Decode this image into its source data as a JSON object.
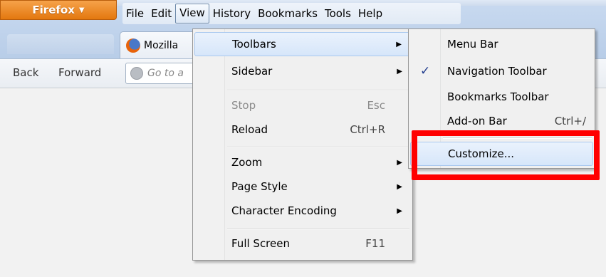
{
  "firefox_button": {
    "label": "Firefox",
    "arrow": "▼"
  },
  "menubar": {
    "items": [
      {
        "label": "File"
      },
      {
        "label": "Edit"
      },
      {
        "label": "View"
      },
      {
        "label": "History"
      },
      {
        "label": "Bookmarks"
      },
      {
        "label": "Tools"
      },
      {
        "label": "Help"
      }
    ]
  },
  "tab": {
    "title": "Mozilla"
  },
  "navbar": {
    "back": "Back",
    "forward": "Forward",
    "url_placeholder": "Go to a"
  },
  "view_menu": {
    "items": [
      {
        "label": "Toolbars",
        "has_submenu": true
      },
      {
        "label": "Sidebar",
        "has_submenu": true
      },
      {
        "label": "Stop",
        "accel": "Esc",
        "disabled": true
      },
      {
        "label": "Reload",
        "accel": "Ctrl+R"
      },
      {
        "label": "Zoom",
        "has_submenu": true
      },
      {
        "label": "Page Style",
        "has_submenu": true
      },
      {
        "label": "Character Encoding",
        "has_submenu": true
      },
      {
        "label": "Full Screen",
        "accel": "F11"
      }
    ]
  },
  "toolbars_submenu": {
    "items": [
      {
        "label": "Menu Bar",
        "checked": false
      },
      {
        "label": "Navigation Toolbar",
        "checked": true
      },
      {
        "label": "Bookmarks Toolbar",
        "checked": false
      },
      {
        "label": "Add-on Bar",
        "accel": "Ctrl+/",
        "checked": false
      },
      {
        "label": "Customize..."
      }
    ],
    "check_glyph": "✓"
  },
  "submenu_arrow": "▶",
  "colors": {
    "highlight": "#ff0000",
    "firefox_orange": "#e3780f"
  }
}
